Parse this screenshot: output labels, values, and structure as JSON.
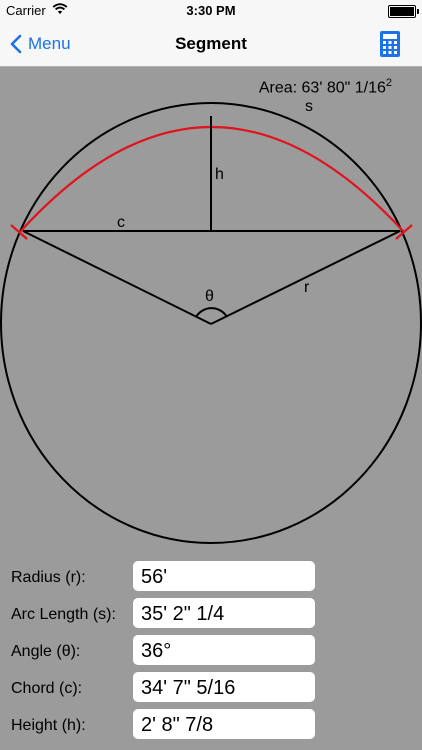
{
  "status_bar": {
    "carrier": "Carrier",
    "time": "3:30 PM"
  },
  "nav": {
    "back_label": "Menu",
    "title": "Segment",
    "right_icon": "calculator-icon"
  },
  "diagram": {
    "area_text": "Area: 63' 80\" 1/16",
    "area_superscript": "2",
    "labels": {
      "s": "s",
      "h": "h",
      "c": "c",
      "theta": "θ",
      "r": "r"
    },
    "arc_color": "#e0141e"
  },
  "fields": [
    {
      "label": "Radius (r):",
      "value": "56'"
    },
    {
      "label": "Arc Length (s):",
      "value": "35' 2\" 1/4"
    },
    {
      "label": "Angle (θ):",
      "value": "36°"
    },
    {
      "label": "Chord (c):",
      "value": "34' 7\" 5/16"
    },
    {
      "label": "Height (h):",
      "value": "2' 8\" 7/8"
    }
  ],
  "colors": {
    "background": "#9b9b9b",
    "tint": "#1a73e8"
  }
}
